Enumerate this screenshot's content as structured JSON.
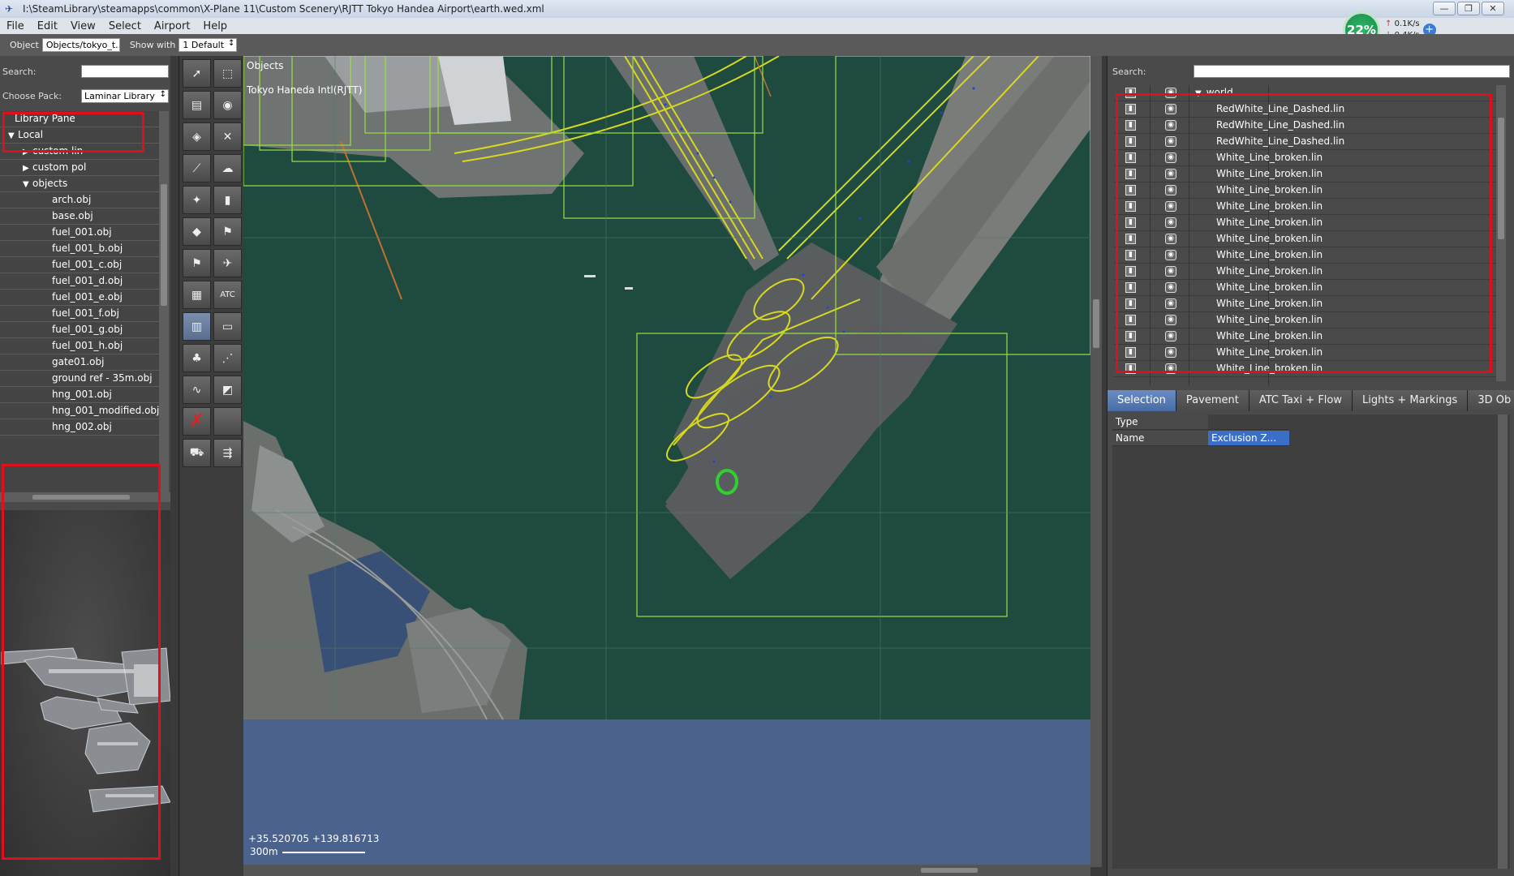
{
  "window": {
    "title": "I:\\SteamLibrary\\steamapps\\common\\X-Plane 11\\Custom Scenery\\RJTT Tokyo Handea Airport\\earth.wed.xml",
    "minimize": "—",
    "restore": "❐",
    "close": "✕"
  },
  "menu": [
    "File",
    "Edit",
    "View",
    "Select",
    "Airport",
    "Help"
  ],
  "net_widget": {
    "percent": "22%",
    "up": "0.1K/s",
    "down": "0.4K/s"
  },
  "toolbar": {
    "object_label": "Object",
    "object_value": "Objects/tokyo_t...",
    "show_with_label": "Show with",
    "show_with_value": "1 Default"
  },
  "library": {
    "search_label": "Search:",
    "pack_label": "Choose Pack:",
    "pack_value": "Laminar Library",
    "items": [
      {
        "label": "Library Pane",
        "tri": "",
        "level": 0
      },
      {
        "label": "Local",
        "tri": "▼",
        "level": 1
      },
      {
        "label": "custom lin",
        "tri": "▶",
        "level": 2
      },
      {
        "label": "custom pol",
        "tri": "▶",
        "level": 2
      },
      {
        "label": "objects",
        "tri": "▼",
        "level": 2
      },
      {
        "label": "arch.obj",
        "tri": "",
        "level": 3
      },
      {
        "label": "base.obj",
        "tri": "",
        "level": 3
      },
      {
        "label": "fuel_001.obj",
        "tri": "",
        "level": 3
      },
      {
        "label": "fuel_001_b.obj",
        "tri": "",
        "level": 3
      },
      {
        "label": "fuel_001_c.obj",
        "tri": "",
        "level": 3
      },
      {
        "label": "fuel_001_d.obj",
        "tri": "",
        "level": 3
      },
      {
        "label": "fuel_001_e.obj",
        "tri": "",
        "level": 3
      },
      {
        "label": "fuel_001_f.obj",
        "tri": "",
        "level": 3
      },
      {
        "label": "fuel_001_g.obj",
        "tri": "",
        "level": 3
      },
      {
        "label": "fuel_001_h.obj",
        "tri": "",
        "level": 3
      },
      {
        "label": "gate01.obj",
        "tri": "",
        "level": 3
      },
      {
        "label": "ground ref - 35m.obj",
        "tri": "",
        "level": 3
      },
      {
        "label": "hng_001.obj",
        "tri": "",
        "level": 3
      },
      {
        "label": "hng_001_modified.obj",
        "tri": "",
        "level": 3
      },
      {
        "label": "hng_002.obj",
        "tri": "",
        "level": 3
      }
    ]
  },
  "tools": [
    {
      "name": "vertex-select-tool",
      "glyph": "➚"
    },
    {
      "name": "marquee-select-tool",
      "glyph": "⬚"
    },
    {
      "name": "runway-tool",
      "glyph": "▤"
    },
    {
      "name": "helipad-tool",
      "glyph": "◉"
    },
    {
      "name": "sealane-tool",
      "glyph": "◈"
    },
    {
      "name": "taxiway-tool",
      "glyph": "✕"
    },
    {
      "name": "taxi-line-tool",
      "glyph": "⟋"
    },
    {
      "name": "boundary-tool",
      "glyph": "☁"
    },
    {
      "name": "light-fixture-tool",
      "glyph": "✦"
    },
    {
      "name": "sign-tool",
      "glyph": "▮"
    },
    {
      "name": "beacon-tool",
      "glyph": "◆"
    },
    {
      "name": "windsock-tool",
      "glyph": "⚑"
    },
    {
      "name": "tower-viewpoint-tool",
      "glyph": "⚑"
    },
    {
      "name": "ramp-start-tool",
      "glyph": "✈"
    },
    {
      "name": "facade-tool",
      "glyph": "▦"
    },
    {
      "name": "atc-tool",
      "glyph": "ATC"
    },
    {
      "name": "object-tool",
      "glyph": "▥"
    },
    {
      "name": "draped-polygon-tool",
      "glyph": "▭"
    },
    {
      "name": "forest-tool",
      "glyph": "♣"
    },
    {
      "name": "string-tool",
      "glyph": "⋰"
    },
    {
      "name": "line-tool",
      "glyph": "∿"
    },
    {
      "name": "polygon-tool",
      "glyph": "◩"
    },
    {
      "name": "exclusion-tool",
      "glyph": "✗"
    },
    {
      "name": "blank-tool",
      "glyph": ""
    },
    {
      "name": "truck-parking-tool",
      "glyph": "⛟"
    },
    {
      "name": "truck-destination-tool",
      "glyph": "⇶"
    }
  ],
  "map": {
    "layer_label": "Objects",
    "airport_label": "Tokyo Haneda Intl(RJTT)",
    "coords": "+35.520705 +139.816713",
    "scale": "300m"
  },
  "hierarchy": {
    "search_label": "Search:",
    "root": "world",
    "items": [
      "RedWhite_Line_Dashed.lin",
      "RedWhite_Line_Dashed.lin",
      "RedWhite_Line_Dashed.lin",
      "White_Line_broken.lin",
      "White_Line_broken.lin",
      "White_Line_broken.lin",
      "White_Line_broken.lin",
      "White_Line_broken.lin",
      "White_Line_broken.lin",
      "White_Line_broken.lin",
      "White_Line_broken.lin",
      "White_Line_broken.lin",
      "White_Line_broken.lin",
      "White_Line_broken.lin",
      "White_Line_broken.lin",
      "White_Line_broken.lin",
      "White_Line_broken.lin"
    ]
  },
  "tabs": [
    {
      "label": "Selection",
      "active": true
    },
    {
      "label": "Pavement",
      "active": false
    },
    {
      "label": "ATC Taxi + Flow",
      "active": false
    },
    {
      "label": "Lights + Markings",
      "active": false
    },
    {
      "label": "3D Ob",
      "active": false
    }
  ],
  "properties": [
    {
      "key": "Type",
      "value": "",
      "hl": false
    },
    {
      "key": "Name",
      "value": "Exclusion Z...",
      "hl": true
    }
  ],
  "colors": {
    "water": "#1e4a3f",
    "void": "#4a628c",
    "highlight": "#3b6fc7",
    "annotation_red": "#e0101a",
    "taxiline_yellow": "#d8d820"
  }
}
